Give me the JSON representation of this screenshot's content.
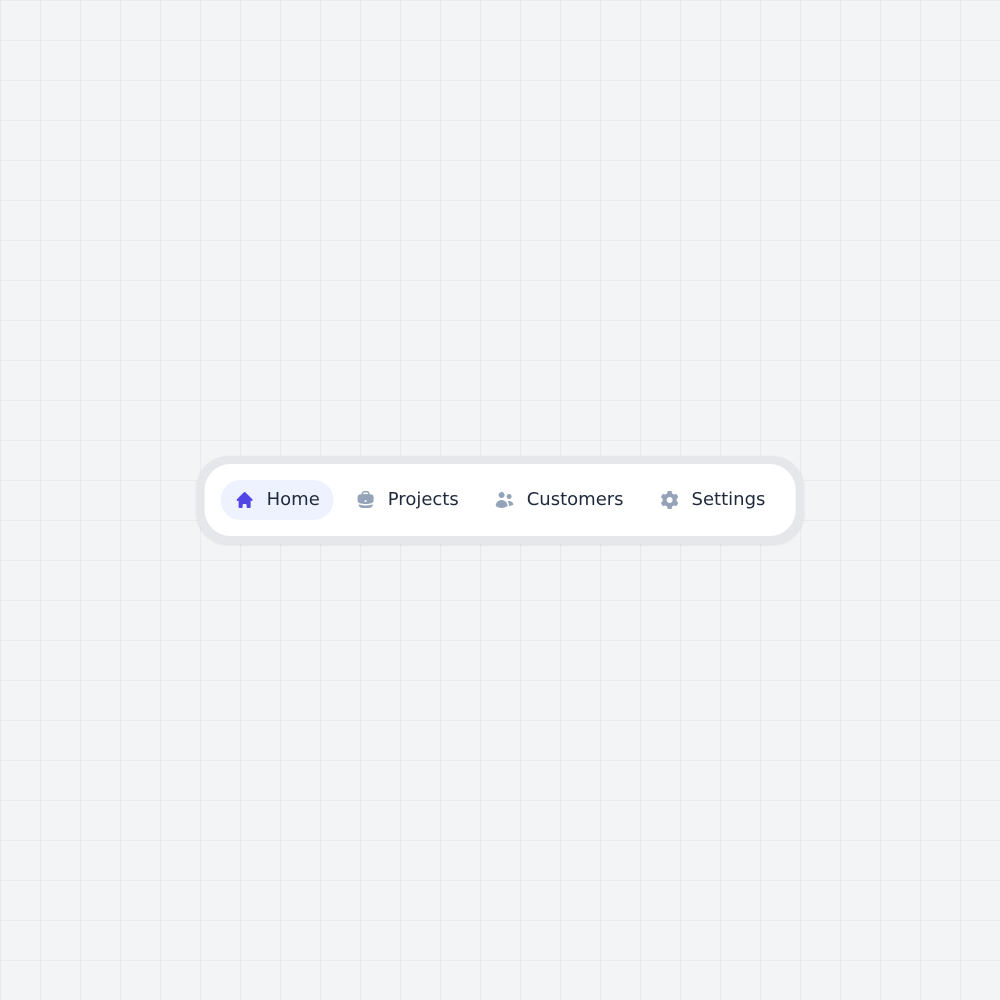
{
  "colors": {
    "accent": "#5046e5",
    "inactive_icon": "#94a3b8",
    "active_bg": "#eef2ff",
    "text": "#1e293b",
    "page_bg": "#f3f4f6",
    "outer_bg": "#e5e7eb"
  },
  "menu": {
    "items": [
      {
        "label": "Home",
        "icon": "home-icon",
        "active": true
      },
      {
        "label": "Projects",
        "icon": "briefcase-icon",
        "active": false
      },
      {
        "label": "Customers",
        "icon": "users-icon",
        "active": false
      },
      {
        "label": "Settings",
        "icon": "gear-icon",
        "active": false
      }
    ]
  }
}
